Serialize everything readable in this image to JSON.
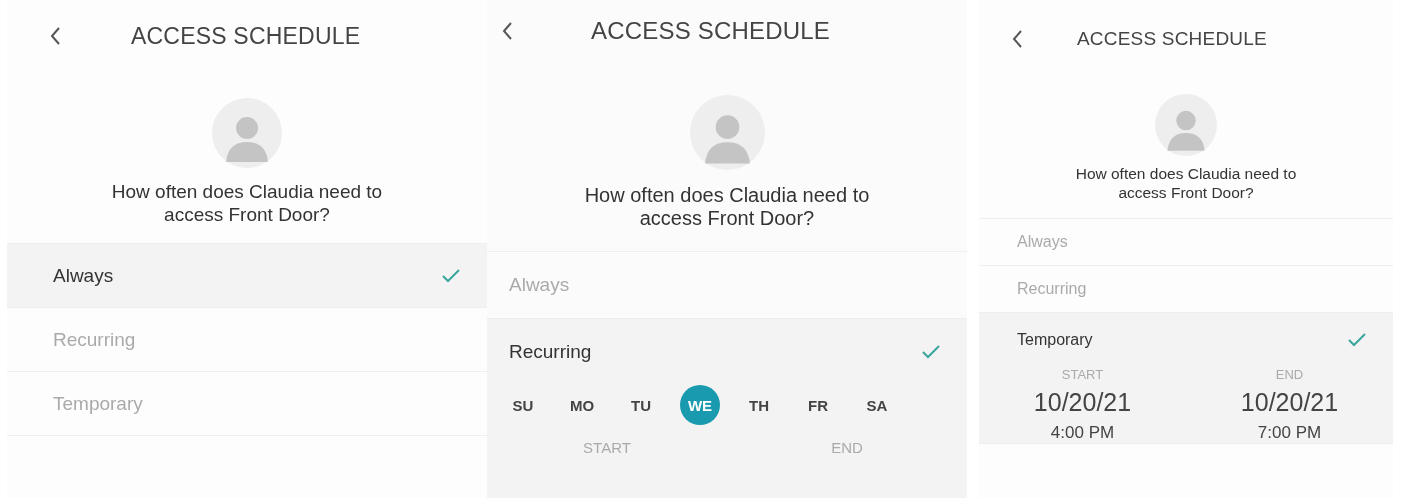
{
  "screens": [
    {
      "title": "ACCESS SCHEDULE",
      "question": "How often does Claudia need to access Front Door?",
      "options": [
        {
          "label": "Always",
          "selected": true
        },
        {
          "label": "Recurring",
          "selected": false
        },
        {
          "label": "Temporary",
          "selected": false
        }
      ]
    },
    {
      "title": "ACCESS SCHEDULE",
      "question": "How often does Claudia need to access Front Door?",
      "options": [
        {
          "label": "Always",
          "selected": false
        },
        {
          "label": "Recurring",
          "selected": true,
          "detail": {
            "kind": "days",
            "days": [
              {
                "label": "SU",
                "selected": false
              },
              {
                "label": "MO",
                "selected": false
              },
              {
                "label": "TU",
                "selected": false
              },
              {
                "label": "WE",
                "selected": true
              },
              {
                "label": "TH",
                "selected": false
              },
              {
                "label": "FR",
                "selected": false
              },
              {
                "label": "SA",
                "selected": false
              }
            ],
            "start": {
              "label": "START"
            },
            "end": {
              "label": "END"
            }
          }
        }
      ]
    },
    {
      "title": "ACCESS SCHEDULE",
      "question": "How often does Claudia need to access Front Door?",
      "options": [
        {
          "label": "Always",
          "selected": false
        },
        {
          "label": "Recurring",
          "selected": false
        },
        {
          "label": "Temporary",
          "selected": true,
          "detail": {
            "kind": "range",
            "start": {
              "label": "START",
              "date": "10/20/21",
              "time": "4:00 PM"
            },
            "end": {
              "label": "END",
              "date": "10/20/21",
              "time": "7:00 PM"
            }
          }
        }
      ]
    }
  ]
}
